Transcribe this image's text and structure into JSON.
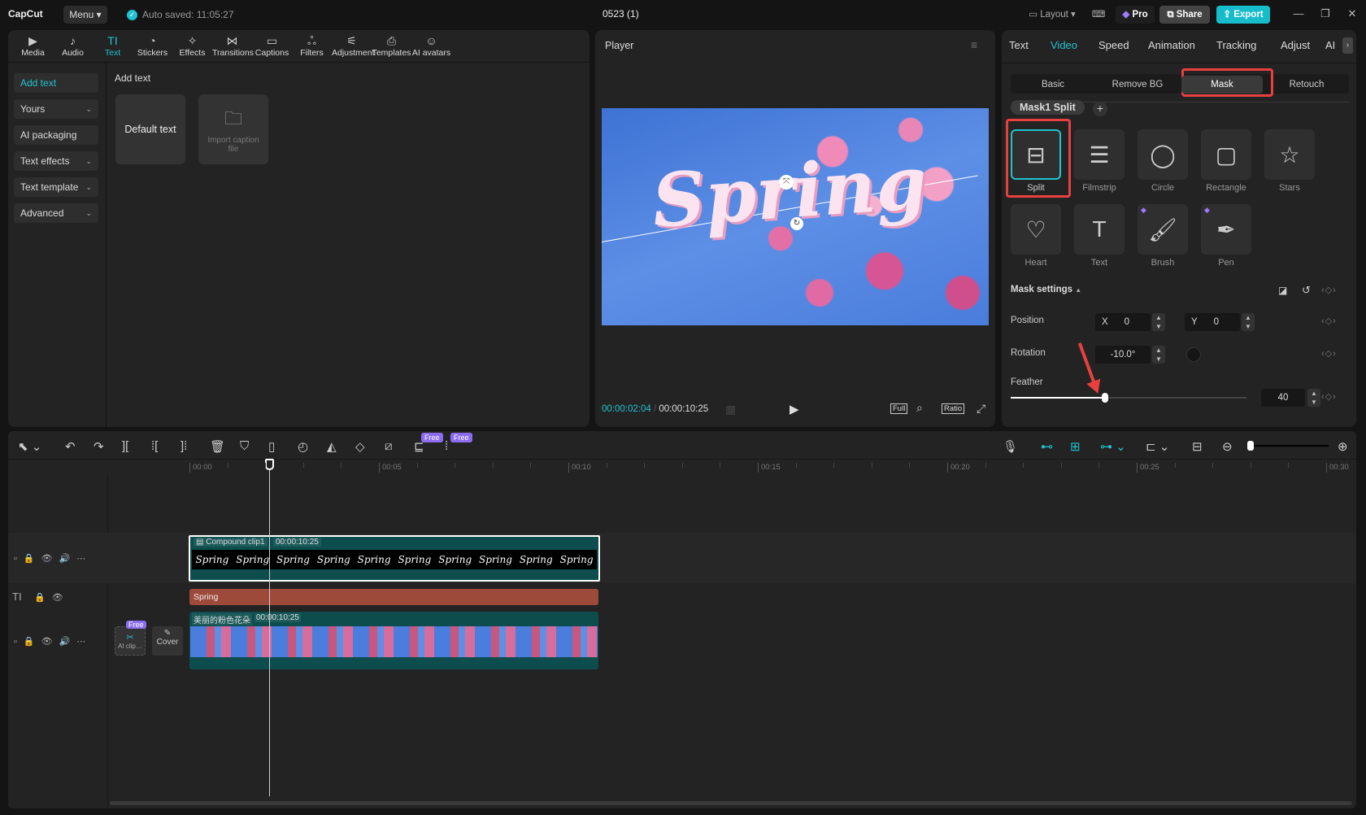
{
  "app": {
    "logo": "CapCut",
    "menu": "Menu",
    "autosave": "Auto saved: 11:05:27",
    "project": "0523 (1)",
    "layout": "Layout",
    "pro": "Pro",
    "share": "Share",
    "export": "Export"
  },
  "toolbar": [
    {
      "label": "Media",
      "icon": "▶"
    },
    {
      "label": "Audio",
      "icon": "♪"
    },
    {
      "label": "Text",
      "icon": "TI"
    },
    {
      "label": "Stickers",
      "icon": "◔"
    },
    {
      "label": "Effects",
      "icon": "✧"
    },
    {
      "label": "Transitions",
      "icon": "⋈"
    },
    {
      "label": "Captions",
      "icon": "▭"
    },
    {
      "label": "Filters",
      "icon": "ஃ"
    },
    {
      "label": "Adjustment",
      "icon": "⚟"
    },
    {
      "label": "Templates",
      "icon": "⎙"
    },
    {
      "label": "AI avatars",
      "icon": "☺"
    }
  ],
  "left_nav": [
    {
      "label": "Add text"
    },
    {
      "label": "Yours"
    },
    {
      "label": "AI packaging"
    },
    {
      "label": "Text effects"
    },
    {
      "label": "Text template"
    },
    {
      "label": "Advanced"
    }
  ],
  "content": {
    "heading": "Add text",
    "default_text": "Default text",
    "import_caption": "Import caption file"
  },
  "player": {
    "title": "Player",
    "overlay_text": "Spring",
    "current_time": "00:00:02:04",
    "total_time": "00:00:10:25",
    "full": "Full",
    "ratio": "Ratio"
  },
  "right": {
    "tabs": [
      "Text",
      "Video",
      "Speed",
      "Animation",
      "Tracking",
      "Adjust",
      "AI"
    ],
    "active_tab": "Video",
    "subtabs": [
      "Basic",
      "Remove BG",
      "Mask",
      "Retouch"
    ],
    "active_subtab": "Mask",
    "mask_chip": "Mask1 Split",
    "masks": [
      {
        "label": "Split"
      },
      {
        "label": "Filmstrip"
      },
      {
        "label": "Circle"
      },
      {
        "label": "Rectangle"
      },
      {
        "label": "Stars"
      },
      {
        "label": "Heart"
      },
      {
        "label": "Text"
      },
      {
        "label": "Brush"
      },
      {
        "label": "Pen"
      }
    ],
    "settings_title": "Mask settings",
    "position_label": "Position",
    "x_label": "X",
    "x": "0",
    "y_label": "Y",
    "y": "0",
    "rotation_label": "Rotation",
    "rotation": "-10.0°",
    "feather_label": "Feather",
    "feather": "40",
    "feather_fraction": 0.4,
    "accent": "#22c3d1",
    "highlight": "#e8403f"
  },
  "timeline": {
    "free_badge": "Free",
    "ruler": [
      "00:00",
      "00:05",
      "00:10",
      "00:15",
      "00:20",
      "00:25",
      "00:30"
    ],
    "compound": {
      "name": "Compound clip1",
      "duration": "00:00:10:25",
      "frame_text": "Spring"
    },
    "text_clip": "Spring",
    "video": {
      "name": "美丽的粉色花朵",
      "duration": "00:00:10:25"
    },
    "ai_clip": "AI clip…",
    "cover": "Cover"
  }
}
